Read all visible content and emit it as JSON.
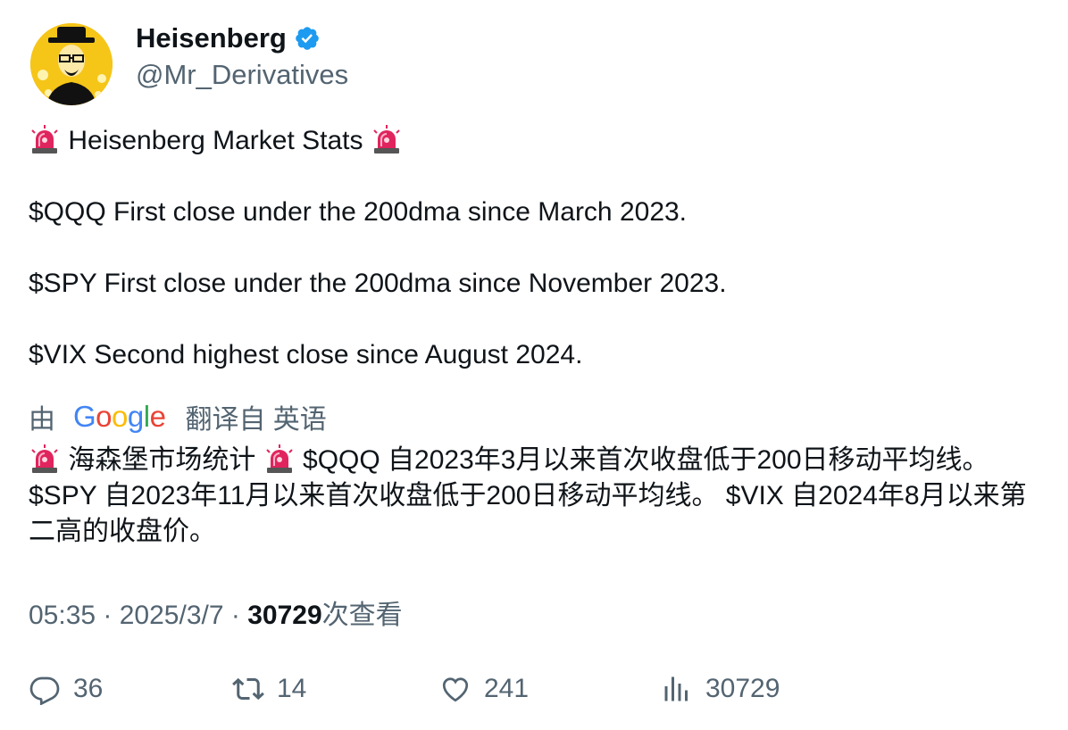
{
  "author": {
    "display_name": "Heisenberg",
    "handle": "@Mr_Derivatives",
    "verified": true,
    "verified_color": "#1d9bf0"
  },
  "tweet": {
    "lines": [
      "Heisenberg Market Stats",
      "$QQQ First close under the 200dma since March 2023.",
      "$SPY First close under the 200dma since November 2023.",
      "$VIX Second highest close since August 2024."
    ],
    "emoji": "siren-emoji"
  },
  "translation": {
    "prefix": "由",
    "provider": "Google",
    "suffix": "翻译自 英语",
    "seg1": "海森堡市场统计",
    "seg2": "$QQQ 自2023年3月以来首次收盘低于200日移动平均线。 $SPY 自2023年11月以来首次收盘低于200日移动平均线。 $VIX 自2024年8月以来第二高的收盘价。"
  },
  "meta": {
    "time": "05:35",
    "sep1": " · ",
    "date": "2025/3/7",
    "sep2": " · ",
    "views": "30729",
    "views_label": "次查看"
  },
  "actions": {
    "replies": "36",
    "retweets": "14",
    "likes": "241",
    "views": "30729"
  },
  "colors": {
    "text": "#0f1419",
    "secondary": "#536471",
    "avatar_bg": "#f5c518",
    "siren_red": "#e0245e"
  }
}
